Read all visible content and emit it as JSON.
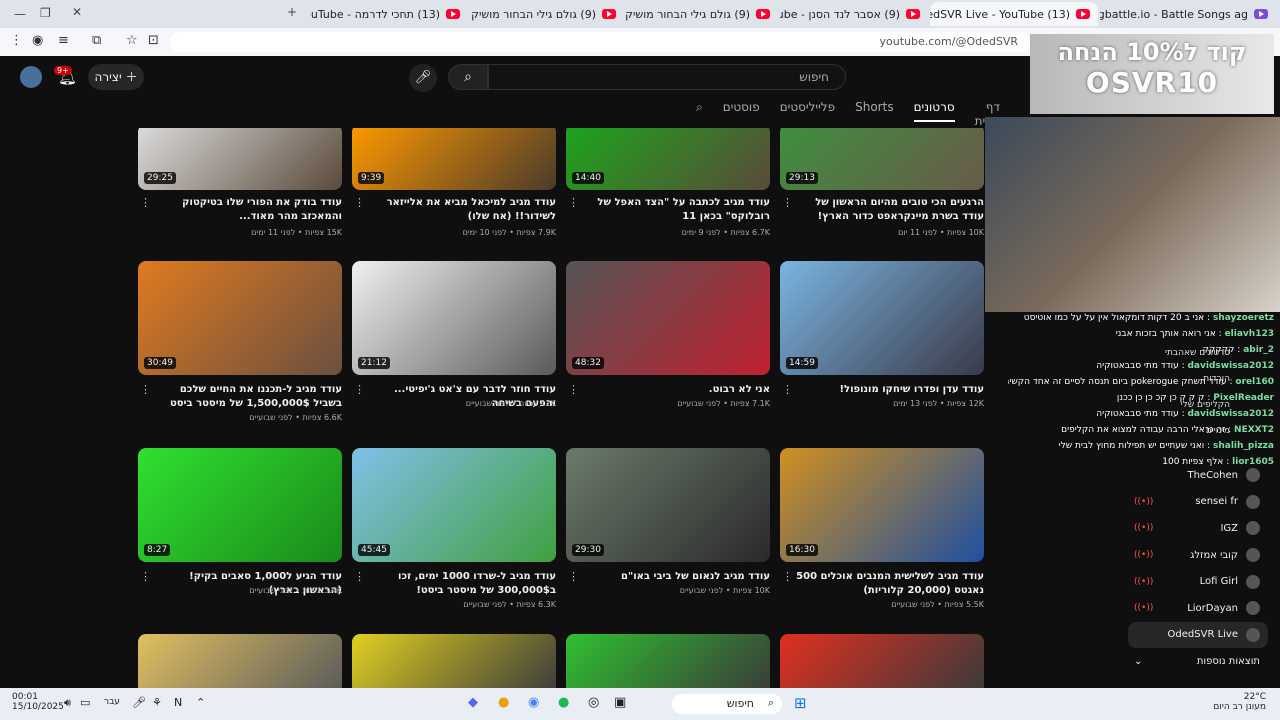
{
  "tabs": [
    {
      "title": "songbattle.io - Battle Songs ag"
    },
    {
      "title": "(13) OdedSVR Live - YouTube",
      "active": true
    },
    {
      "title": "(9) אסבר לנד הסנן - YouTube"
    },
    {
      "title": "(9) גולם גילי הבחור מושיק עפיה פ"
    },
    {
      "title": "(9) גולם גילי הבחור מושיק עפיה"
    },
    {
      "title": "(13) תחכי לדרמה - YouTube"
    }
  ],
  "address": {
    "url": "youtube.com/@OdedSVR"
  },
  "header": {
    "search_placeholder": "חיפוש",
    "create_label": "יצירה",
    "notif_count": "9+"
  },
  "channel_tabs": [
    "דף הבית",
    "סרטונים",
    "Shorts",
    "פלייליסטים",
    "פוסטים"
  ],
  "promo": {
    "line1": "קוד ל10% הנחה",
    "line2": "OSVR10"
  },
  "videos": [
    {
      "title": "הרגעים הכי טובים מהיום הראשון של עודד בשרת מיינקראפט כדור הארץ!",
      "meta": "10K צפיות • לפני 11 יום",
      "duration": "29:13"
    },
    {
      "title": "עודד מגיב לכתבה על \"הצד האפל של רובלוקס\" בכאן 11",
      "meta": "6.7K צפיות • לפני 9 ימים",
      "duration": "14:40"
    },
    {
      "title": "עודד מגיב למיכאל מביא את אלייזאר לשידור!! (אח שלו)",
      "meta": "7.9K צפיות • לפני 10 ימים",
      "duration": "9:39"
    },
    {
      "title": "עודד בודק את הפורי שלו בטיקטוק והמאכזב מהר מאוד...",
      "meta": "15K צפיות • לפני 11 ימים",
      "duration": "29:25"
    },
    {
      "title": "עודד עדן ופדרו שיחקו מונופול!",
      "meta": "12K צפיות • לפני 13 ימים",
      "duration": "14:59"
    },
    {
      "title": "אני לא רבוט.",
      "meta": "7.1K צפיות • לפני שבועיים",
      "duration": "48:32"
    },
    {
      "title": "עודד חוזר לדבר עם צ'אט ג'יפיטי... והפעם בשיחה",
      "meta": "12K צפיות • לפני שבועיים",
      "duration": "21:12"
    },
    {
      "title": "עודד מגיב ל-תכננו את החיים שלכם בשביל 1,500,000$ של מיסטר ביסט",
      "meta": "6.6K צפיות • לפני שבועיים",
      "duration": "30:49"
    },
    {
      "title": "עודד מגיב לשלישית המנבים אוכלים 500 נאגטס (20,000 קלוריות)",
      "meta": "5.5K צפיות • לפני שבועיים",
      "duration": "16:30"
    },
    {
      "title": "עודד מגיב לנאום של ביבי באו\"ם",
      "meta": "10K צפיות • לפני שבועיים",
      "duration": "29:30"
    },
    {
      "title": "עודד מגיב ל-שרדו 1000 ימים, זכו ב300,000$ של מיסטר ביסט!",
      "meta": "6.3K צפיות • לפני שבועיים",
      "duration": "45:45"
    },
    {
      "title": "עודד הגיע ל1,000 סאבים בקיק! (הראשון בארץ)",
      "meta": "3.4K צפיות • לפני שבועיים",
      "duration": "8:27"
    }
  ],
  "chat": [
    {
      "user": "shayzoeretz",
      "text": "אני ב 20 דקות דומקאול אין על על כמו אוטיסט"
    },
    {
      "user": "eliavh123",
      "text": "אני רואה אותך בזכות אבני"
    },
    {
      "user": "abir_2",
      "text": "קקקקק"
    },
    {
      "user": "davidswissa2012",
      "text": "עודד מתי סבבאטוקיה"
    },
    {
      "user": "orel160",
      "text": "עודד תשחק pokerogue ביום תנסה לסיים זה אחד הקשים"
    },
    {
      "user": "PixelReader",
      "text": "ק ק ק כן קכ כן כן ככנן"
    },
    {
      "user": "davidswissa2012",
      "text": "עודד מתי סבבאטוקיה"
    },
    {
      "user": "NEXXT2",
      "text": "זה נראלי הרבה עבודה למצוא את הקליפים"
    },
    {
      "user": "shalih_pizza",
      "text": "ואני שעתיים יש תפילות מחוץ לבית שלי"
    },
    {
      "user": "lior1605",
      "text": "אלף צפיות 100"
    }
  ],
  "side_menu": [
    "סרטונים שאהבתי",
    "הורדות",
    "הקליפים שלי",
    "מינויים"
  ],
  "live_list": [
    {
      "name": "TheCohen"
    },
    {
      "name": "sensei fr"
    },
    {
      "name": "IGZ"
    },
    {
      "name": "קובי אמזלג"
    },
    {
      "name": "Lofi Girl"
    },
    {
      "name": "LiorDayan"
    },
    {
      "name": "OdedSVR Live",
      "current": true
    }
  ],
  "show_more": "תוצאות נוספות",
  "taskbar": {
    "search": "חיפוש",
    "weather_temp": "22°C",
    "weather_text": "מעונן רב היום",
    "lang": "עבר",
    "time": "00:01",
    "date": "15/10/2025"
  }
}
